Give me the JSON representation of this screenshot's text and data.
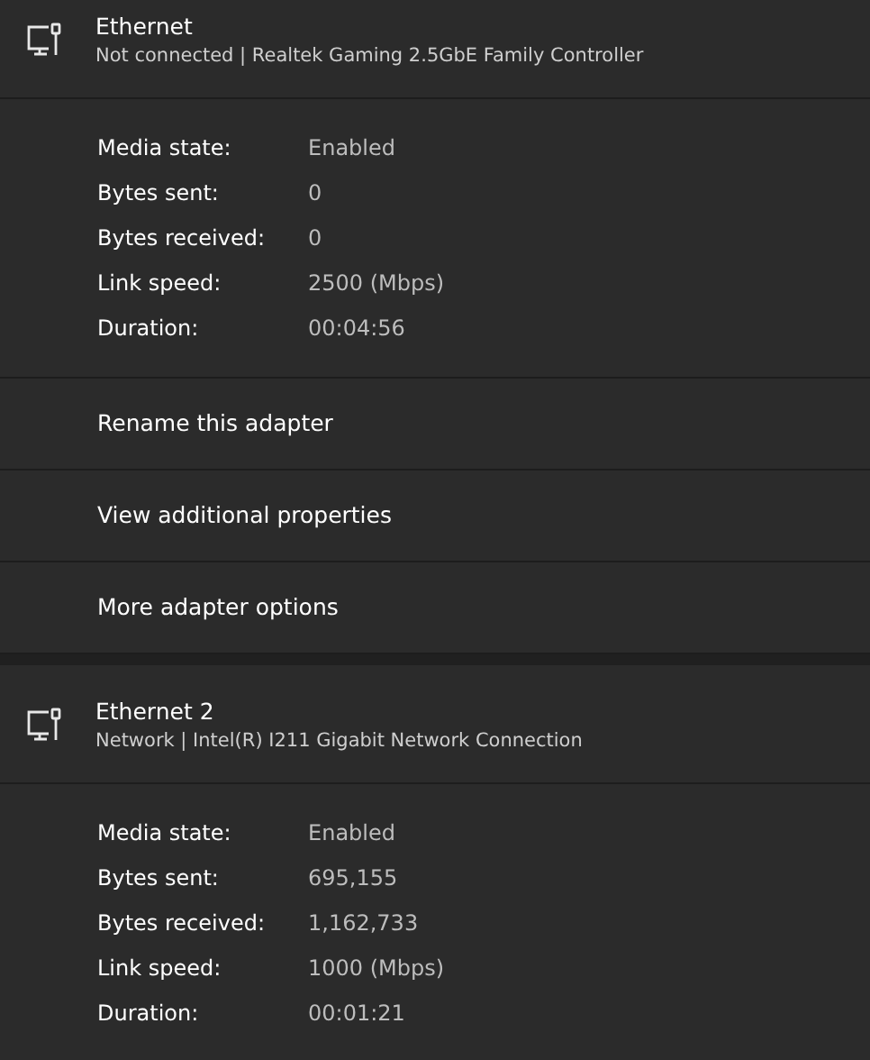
{
  "adapters": [
    {
      "name": "Ethernet",
      "status": "Not connected | Realtek Gaming 2.5GbE Family Controller",
      "properties": [
        {
          "label": "Media state:",
          "value": "Enabled"
        },
        {
          "label": "Bytes sent:",
          "value": "0"
        },
        {
          "label": "Bytes received:",
          "value": "0"
        },
        {
          "label": "Link speed:",
          "value": "2500 (Mbps)"
        },
        {
          "label": "Duration:",
          "value": "00:04:56"
        }
      ],
      "actions": [
        "Rename this adapter",
        "View additional properties",
        "More adapter options"
      ]
    },
    {
      "name": "Ethernet 2",
      "status": "Network | Intel(R) I211 Gigabit Network Connection",
      "properties": [
        {
          "label": "Media state:",
          "value": "Enabled"
        },
        {
          "label": "Bytes sent:",
          "value": "695,155"
        },
        {
          "label": "Bytes received:",
          "value": "1,162,733"
        },
        {
          "label": "Link speed:",
          "value": "1000 (Mbps)"
        },
        {
          "label": "Duration:",
          "value": "00:01:21"
        }
      ]
    }
  ]
}
